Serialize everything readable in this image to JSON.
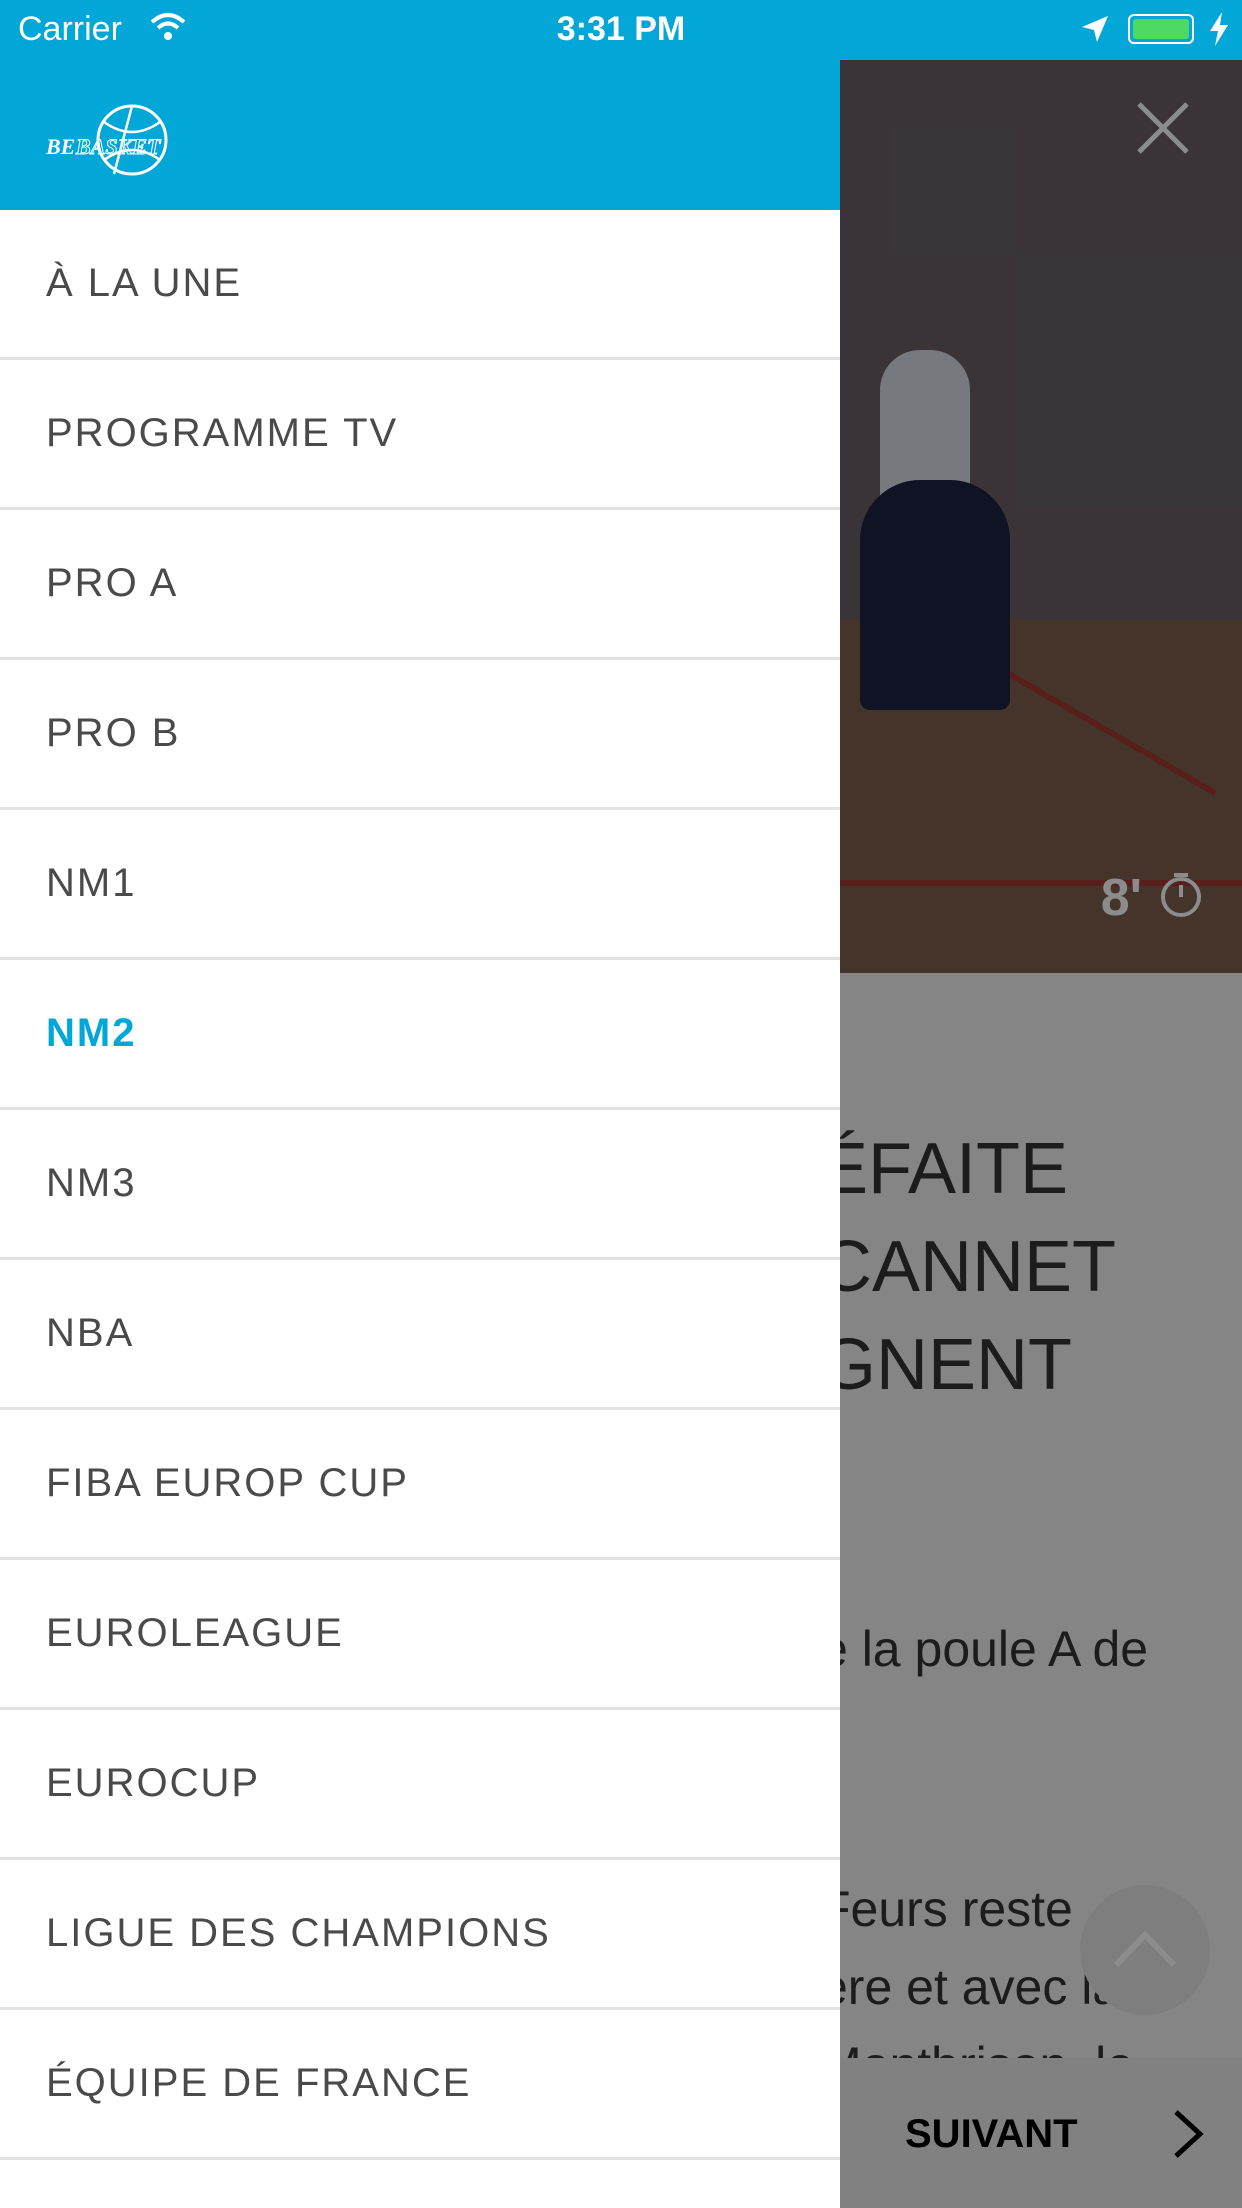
{
  "status_bar": {
    "carrier": "Carrier",
    "time": "3:31 PM"
  },
  "colors": {
    "brand": "#02a7d8",
    "battery": "#4cd964",
    "active_item": "#02a7d8"
  },
  "logo": {
    "text_be": "BE",
    "text_basket": "BASKET"
  },
  "menu": {
    "items": [
      {
        "label": "À LA UNE",
        "active": false
      },
      {
        "label": "PROGRAMME TV",
        "active": false
      },
      {
        "label": "PRO A",
        "active": false
      },
      {
        "label": "PRO B",
        "active": false
      },
      {
        "label": "NM1",
        "active": false
      },
      {
        "label": "NM2",
        "active": true
      },
      {
        "label": "NM3",
        "active": false
      },
      {
        "label": "NBA",
        "active": false
      },
      {
        "label": "FIBA EUROP CUP",
        "active": false
      },
      {
        "label": "EUROLEAGUE",
        "active": false
      },
      {
        "label": "EUROCUP",
        "active": false
      },
      {
        "label": "LIGUE DES CHAMPIONS",
        "active": false
      },
      {
        "label": "ÉQUIPE DE FRANCE",
        "active": false
      }
    ]
  },
  "article": {
    "duration": "8'",
    "title_lines": [
      "ÉFAITE",
      "CANNET",
      "GNENT"
    ],
    "lead": "e la poule A de",
    "body_lines": [
      "Feurs reste",
      "ère et avec la",
      "Montbrison, le"
    ],
    "next_label": "SUIVANT"
  }
}
